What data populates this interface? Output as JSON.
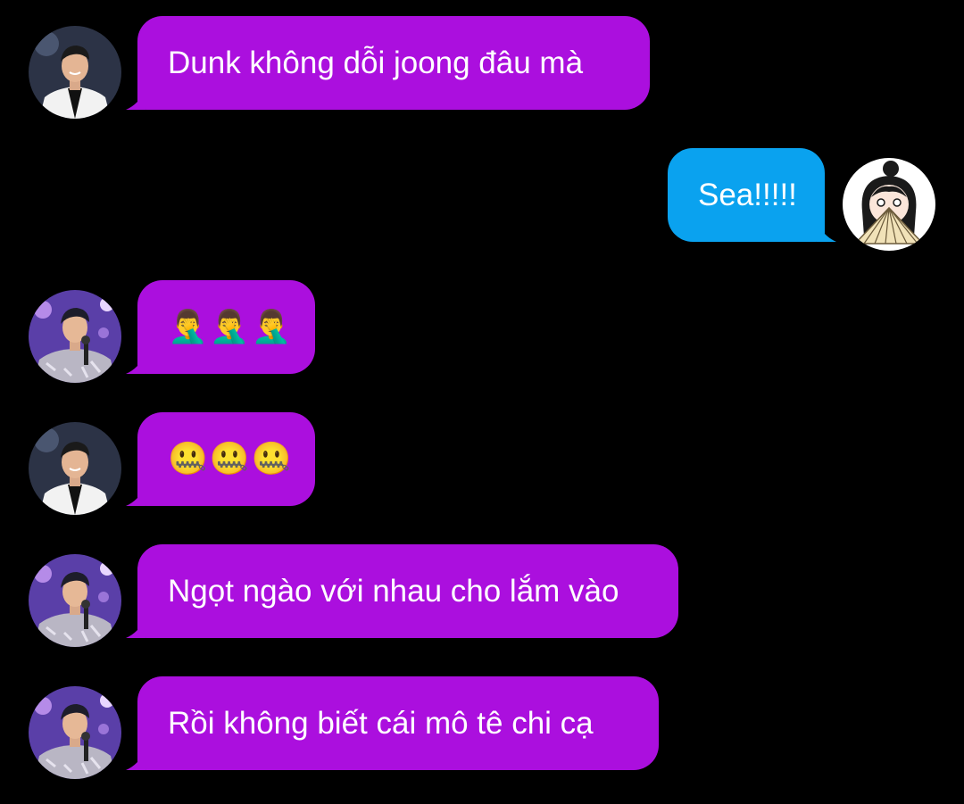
{
  "colors": {
    "background": "#000000",
    "incoming_bubble": "#ab0fde",
    "outgoing_bubble": "#0aa2ef",
    "text": "#ffffff"
  },
  "messages": [
    {
      "direction": "incoming",
      "sender_avatar": "man-white-suit-avatar",
      "text": "Dunk không dỗi joong đâu mà"
    },
    {
      "direction": "outgoing",
      "sender_avatar": "girl-with-fan-avatar",
      "text": "Sea!!!!!"
    },
    {
      "direction": "incoming",
      "sender_avatar": "man-sequin-jacket-avatar",
      "text": "🤦‍♂️🤦‍♂️🤦‍♂️",
      "emoji_names": [
        "man-facepalming-icon",
        "man-facepalming-icon",
        "man-facepalming-icon"
      ]
    },
    {
      "direction": "incoming",
      "sender_avatar": "man-white-suit-avatar",
      "text": "🤐🤐🤐",
      "emoji_names": [
        "zipper-mouth-face-icon",
        "zipper-mouth-face-icon",
        "zipper-mouth-face-icon"
      ]
    },
    {
      "direction": "incoming",
      "sender_avatar": "man-sequin-jacket-avatar",
      "text": "Ngọt ngào với nhau cho lắm vào"
    },
    {
      "direction": "incoming",
      "sender_avatar": "man-sequin-jacket-avatar",
      "text": "Rồi không biết cái mô tê chi cạ"
    }
  ]
}
